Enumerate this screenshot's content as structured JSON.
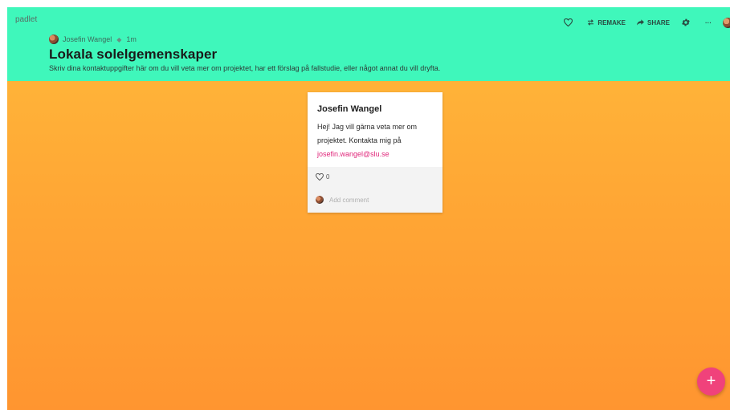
{
  "app": {
    "brand": "padlet"
  },
  "header": {
    "author": "Josefin Wangel",
    "separator": "◆",
    "time_ago": "1m",
    "title": "Lokala solelgemenskaper",
    "description": "Skriv dina kontaktuppgifter här om du vill veta mer om projektet, har ett förslag på fallstudie, eller något annat du vill dryfta.",
    "background_color": "#3ff7bb"
  },
  "actions": {
    "like_icon": "heart-outline-icon",
    "remake_label": "REMAKE",
    "share_label": "SHARE",
    "settings_icon": "gear-icon",
    "more_label": "···",
    "more_icon": "more-icon"
  },
  "post": {
    "author": "Josefin Wangel",
    "body": "Hej! Jag vill gärna veta mer om projektet. Kontakta mig på",
    "email": "josefin.wangel@slu.se",
    "likes": "0",
    "comment_placeholder": "Add comment"
  },
  "fab": {
    "label": "+",
    "color": "#f0427b"
  },
  "colors": {
    "gradient_top": "#ffba3b",
    "gradient_bottom": "#ff9530",
    "link": "#e0267a"
  }
}
